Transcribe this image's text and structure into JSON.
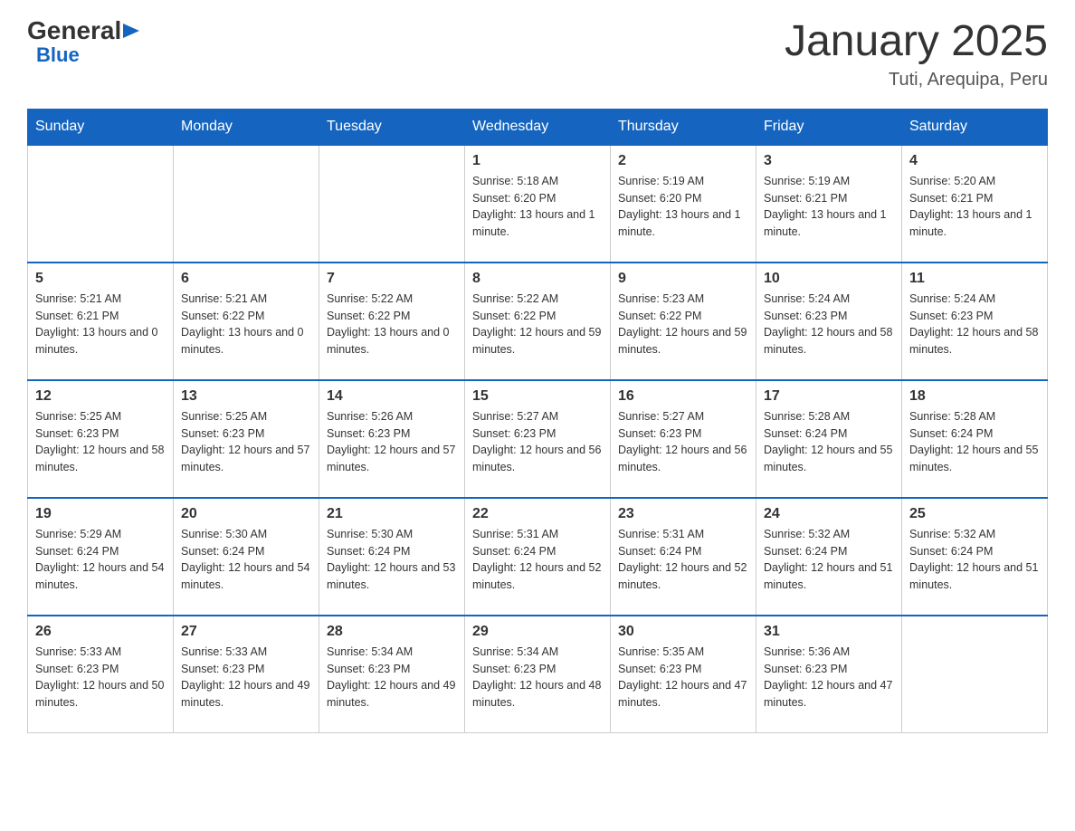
{
  "logo": {
    "general": "General",
    "triangle": "▶",
    "blue": "Blue"
  },
  "title": "January 2025",
  "subtitle": "Tuti, Arequipa, Peru",
  "days": [
    "Sunday",
    "Monday",
    "Tuesday",
    "Wednesday",
    "Thursday",
    "Friday",
    "Saturday"
  ],
  "weeks": [
    [
      {
        "day": "",
        "info": ""
      },
      {
        "day": "",
        "info": ""
      },
      {
        "day": "",
        "info": ""
      },
      {
        "day": "1",
        "info": "Sunrise: 5:18 AM\nSunset: 6:20 PM\nDaylight: 13 hours and 1 minute."
      },
      {
        "day": "2",
        "info": "Sunrise: 5:19 AM\nSunset: 6:20 PM\nDaylight: 13 hours and 1 minute."
      },
      {
        "day": "3",
        "info": "Sunrise: 5:19 AM\nSunset: 6:21 PM\nDaylight: 13 hours and 1 minute."
      },
      {
        "day": "4",
        "info": "Sunrise: 5:20 AM\nSunset: 6:21 PM\nDaylight: 13 hours and 1 minute."
      }
    ],
    [
      {
        "day": "5",
        "info": "Sunrise: 5:21 AM\nSunset: 6:21 PM\nDaylight: 13 hours and 0 minutes."
      },
      {
        "day": "6",
        "info": "Sunrise: 5:21 AM\nSunset: 6:22 PM\nDaylight: 13 hours and 0 minutes."
      },
      {
        "day": "7",
        "info": "Sunrise: 5:22 AM\nSunset: 6:22 PM\nDaylight: 13 hours and 0 minutes."
      },
      {
        "day": "8",
        "info": "Sunrise: 5:22 AM\nSunset: 6:22 PM\nDaylight: 12 hours and 59 minutes."
      },
      {
        "day": "9",
        "info": "Sunrise: 5:23 AM\nSunset: 6:22 PM\nDaylight: 12 hours and 59 minutes."
      },
      {
        "day": "10",
        "info": "Sunrise: 5:24 AM\nSunset: 6:23 PM\nDaylight: 12 hours and 58 minutes."
      },
      {
        "day": "11",
        "info": "Sunrise: 5:24 AM\nSunset: 6:23 PM\nDaylight: 12 hours and 58 minutes."
      }
    ],
    [
      {
        "day": "12",
        "info": "Sunrise: 5:25 AM\nSunset: 6:23 PM\nDaylight: 12 hours and 58 minutes."
      },
      {
        "day": "13",
        "info": "Sunrise: 5:25 AM\nSunset: 6:23 PM\nDaylight: 12 hours and 57 minutes."
      },
      {
        "day": "14",
        "info": "Sunrise: 5:26 AM\nSunset: 6:23 PM\nDaylight: 12 hours and 57 minutes."
      },
      {
        "day": "15",
        "info": "Sunrise: 5:27 AM\nSunset: 6:23 PM\nDaylight: 12 hours and 56 minutes."
      },
      {
        "day": "16",
        "info": "Sunrise: 5:27 AM\nSunset: 6:23 PM\nDaylight: 12 hours and 56 minutes."
      },
      {
        "day": "17",
        "info": "Sunrise: 5:28 AM\nSunset: 6:24 PM\nDaylight: 12 hours and 55 minutes."
      },
      {
        "day": "18",
        "info": "Sunrise: 5:28 AM\nSunset: 6:24 PM\nDaylight: 12 hours and 55 minutes."
      }
    ],
    [
      {
        "day": "19",
        "info": "Sunrise: 5:29 AM\nSunset: 6:24 PM\nDaylight: 12 hours and 54 minutes."
      },
      {
        "day": "20",
        "info": "Sunrise: 5:30 AM\nSunset: 6:24 PM\nDaylight: 12 hours and 54 minutes."
      },
      {
        "day": "21",
        "info": "Sunrise: 5:30 AM\nSunset: 6:24 PM\nDaylight: 12 hours and 53 minutes."
      },
      {
        "day": "22",
        "info": "Sunrise: 5:31 AM\nSunset: 6:24 PM\nDaylight: 12 hours and 52 minutes."
      },
      {
        "day": "23",
        "info": "Sunrise: 5:31 AM\nSunset: 6:24 PM\nDaylight: 12 hours and 52 minutes."
      },
      {
        "day": "24",
        "info": "Sunrise: 5:32 AM\nSunset: 6:24 PM\nDaylight: 12 hours and 51 minutes."
      },
      {
        "day": "25",
        "info": "Sunrise: 5:32 AM\nSunset: 6:24 PM\nDaylight: 12 hours and 51 minutes."
      }
    ],
    [
      {
        "day": "26",
        "info": "Sunrise: 5:33 AM\nSunset: 6:23 PM\nDaylight: 12 hours and 50 minutes."
      },
      {
        "day": "27",
        "info": "Sunrise: 5:33 AM\nSunset: 6:23 PM\nDaylight: 12 hours and 49 minutes."
      },
      {
        "day": "28",
        "info": "Sunrise: 5:34 AM\nSunset: 6:23 PM\nDaylight: 12 hours and 49 minutes."
      },
      {
        "day": "29",
        "info": "Sunrise: 5:34 AM\nSunset: 6:23 PM\nDaylight: 12 hours and 48 minutes."
      },
      {
        "day": "30",
        "info": "Sunrise: 5:35 AM\nSunset: 6:23 PM\nDaylight: 12 hours and 47 minutes."
      },
      {
        "day": "31",
        "info": "Sunrise: 5:36 AM\nSunset: 6:23 PM\nDaylight: 12 hours and 47 minutes."
      },
      {
        "day": "",
        "info": ""
      }
    ]
  ]
}
